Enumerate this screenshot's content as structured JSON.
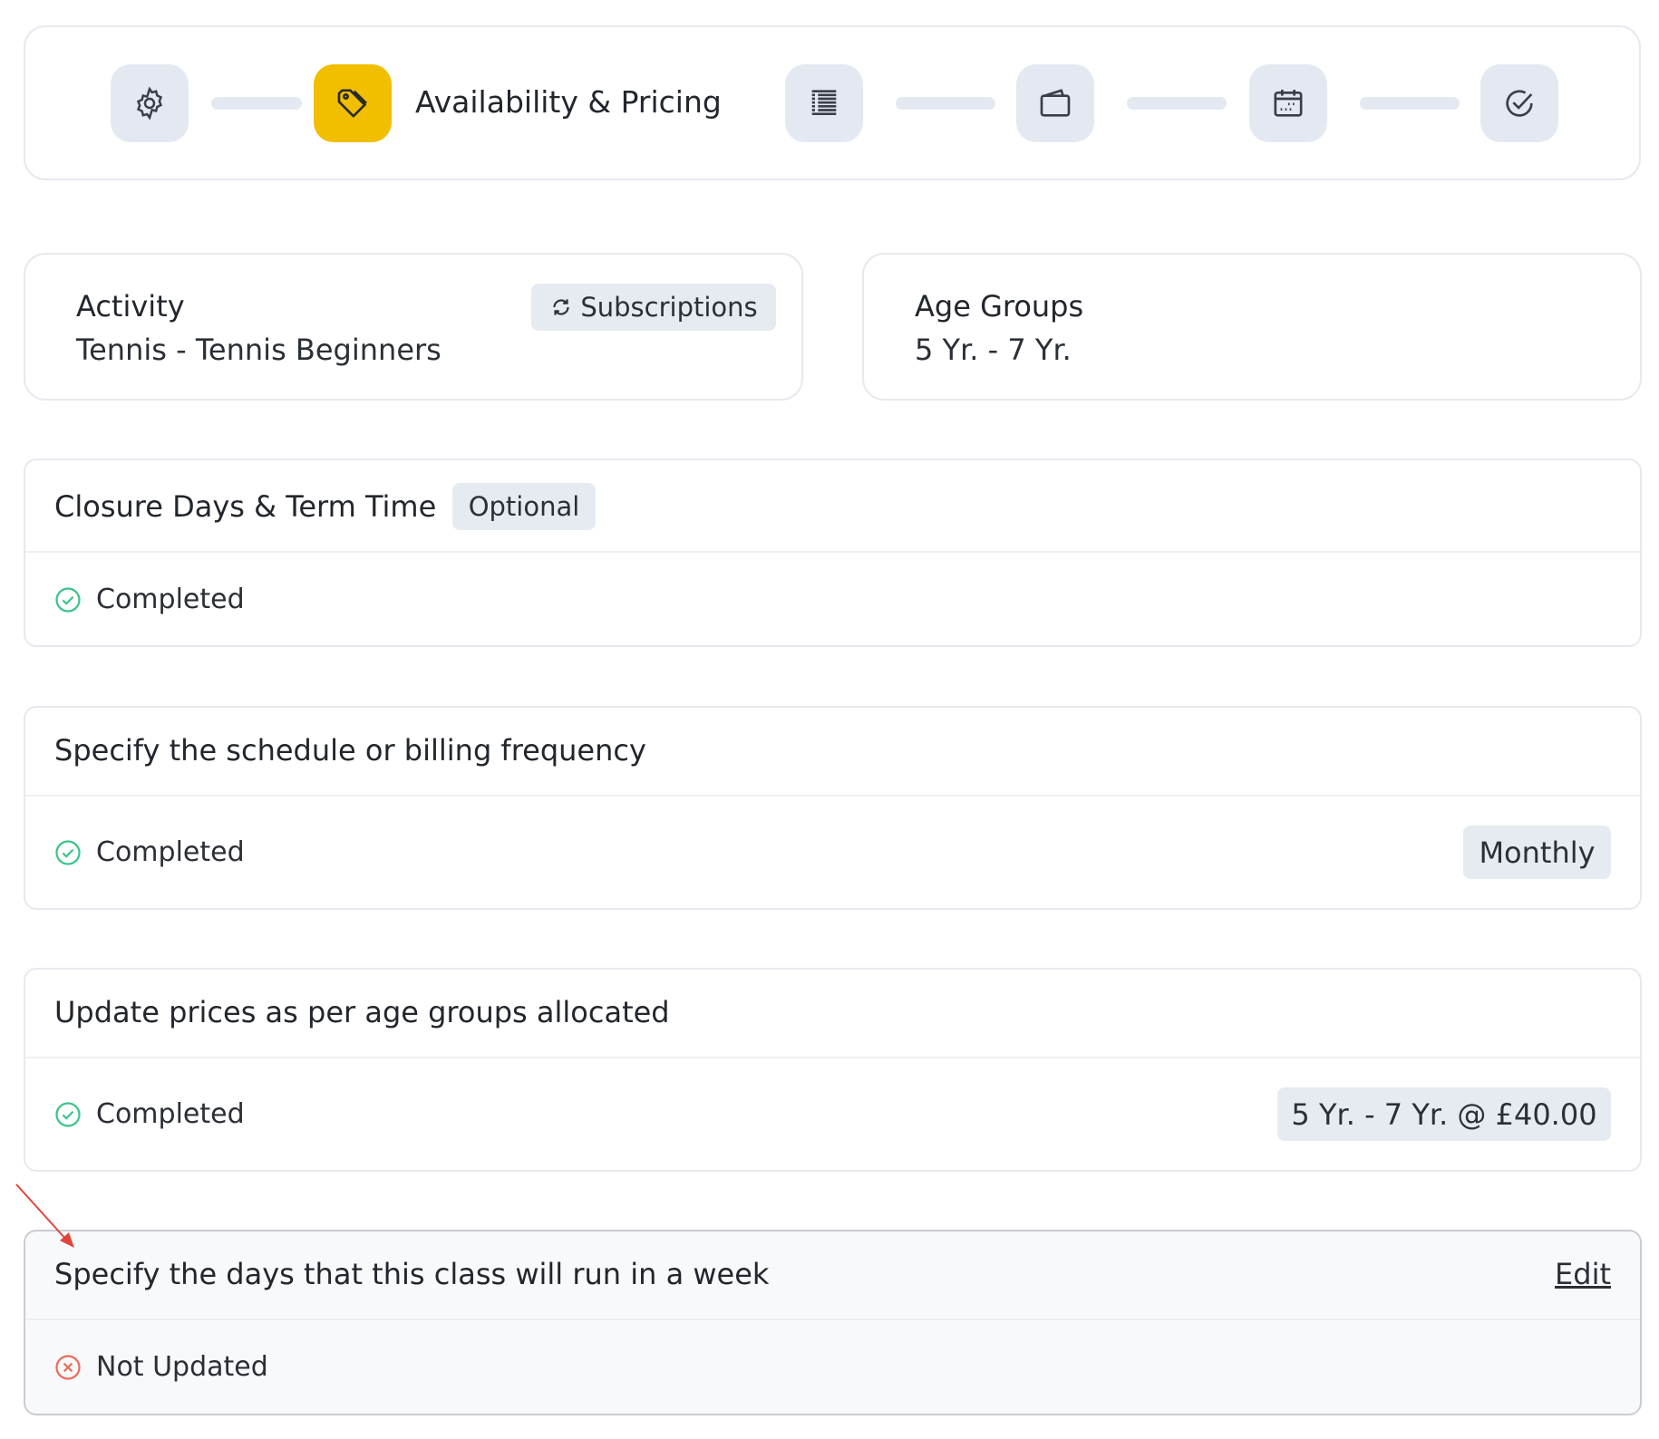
{
  "stepper": {
    "active_label": "Availability & Pricing",
    "steps": [
      {
        "icon": "gear-icon"
      },
      {
        "icon": "price-tag-icon"
      },
      {
        "icon": "list-icon"
      },
      {
        "icon": "wallet-icon"
      },
      {
        "icon": "calendar-icon"
      },
      {
        "icon": "check-circle-icon"
      }
    ]
  },
  "activity_card": {
    "title": "Activity",
    "value": "Tennis - Tennis Beginners",
    "badge": "Subscriptions"
  },
  "age_groups_card": {
    "title": "Age Groups",
    "value": "5 Yr. - 7 Yr."
  },
  "sections": {
    "closure": {
      "title": "Closure Days & Term Time",
      "tag": "Optional",
      "status": "Completed"
    },
    "schedule": {
      "title": "Specify the schedule or billing frequency",
      "status": "Completed",
      "value": "Monthly"
    },
    "prices": {
      "title": "Update prices as per age groups allocated",
      "status": "Completed",
      "value": "5 Yr. - 7 Yr. @ £40.00"
    },
    "days": {
      "title": "Specify the days that this class will run in a week",
      "status": "Not Updated",
      "edit_label": "Edit"
    }
  },
  "colors": {
    "active_step": "#f2bf00",
    "inactive_step": "#e4e9f1",
    "completed": "#3cc48a",
    "not_updated": "#ee6b5a",
    "annotation_arrow": "#e0443a"
  }
}
